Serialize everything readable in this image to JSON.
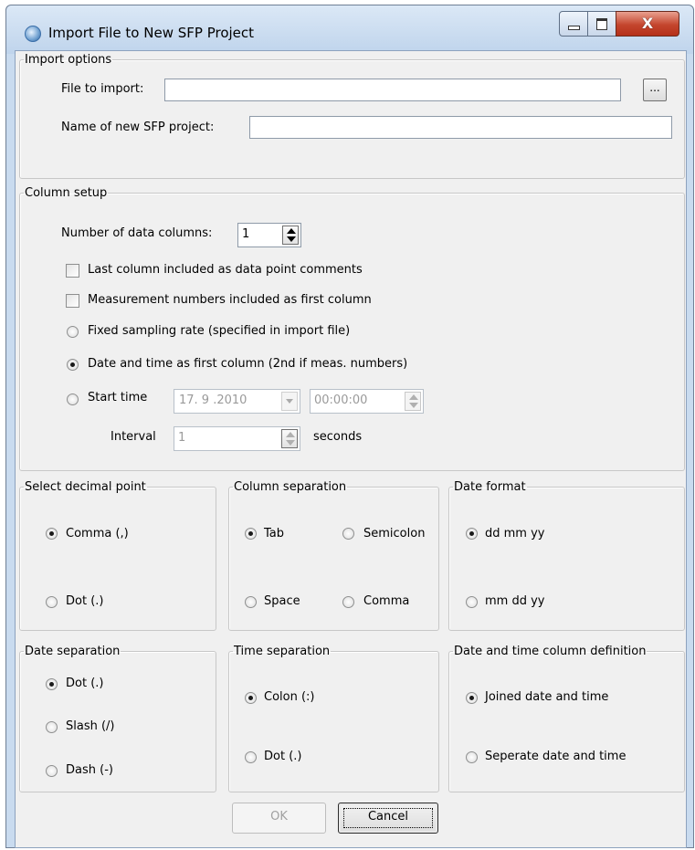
{
  "window": {
    "title": "Import File to New SFP Project",
    "close_glyph": "X"
  },
  "import_options": {
    "legend": "Import options",
    "file_label": "File to import:",
    "file_value": "",
    "browse_label": "...",
    "name_label": "Name of new SFP project:",
    "name_value": ""
  },
  "column_setup": {
    "legend": "Column setup",
    "num_columns_label": "Number of data columns:",
    "num_columns_value": "1",
    "last_column_comments": {
      "label": "Last column included as data point comments",
      "checked": false
    },
    "measurement_numbers": {
      "label": "Measurement numbers included as first column",
      "checked": false
    },
    "fixed_rate": {
      "label": "Fixed sampling rate (specified in import file)",
      "selected": false
    },
    "date_time_first": {
      "label": "Date and time as first column (2nd if meas. numbers)",
      "selected": true
    },
    "start_time": {
      "label": "Start time",
      "selected": false,
      "date_value": "17. 9 .2010",
      "time_value": "00:00:00"
    },
    "interval_label": "Interval",
    "interval_value": "1",
    "interval_unit": "seconds"
  },
  "decimal_point": {
    "legend": "Select decimal point",
    "options": [
      {
        "label": "Comma (,)",
        "selected": true
      },
      {
        "label": "Dot (.)",
        "selected": false
      }
    ]
  },
  "column_separation": {
    "legend": "Column separation",
    "options": [
      {
        "label": "Tab",
        "selected": true
      },
      {
        "label": "Semicolon",
        "selected": false
      },
      {
        "label": "Space",
        "selected": false
      },
      {
        "label": "Comma",
        "selected": false
      }
    ]
  },
  "date_format": {
    "legend": "Date format",
    "options": [
      {
        "label": "dd mm yy",
        "selected": true
      },
      {
        "label": "mm dd yy",
        "selected": false
      }
    ]
  },
  "date_separation": {
    "legend": "Date separation",
    "options": [
      {
        "label": "Dot (.)",
        "selected": true
      },
      {
        "label": "Slash (/)",
        "selected": false
      },
      {
        "label": "Dash (-)",
        "selected": false
      }
    ]
  },
  "time_separation": {
    "legend": "Time separation",
    "options": [
      {
        "label": "Colon (:)",
        "selected": true
      },
      {
        "label": "Dot (.)",
        "selected": false
      }
    ]
  },
  "date_time_column": {
    "legend": "Date and time column definition",
    "options": [
      {
        "label": "Joined date and time",
        "selected": true
      },
      {
        "label": "Seperate date and time",
        "selected": false
      }
    ]
  },
  "buttons": {
    "ok_label": "OK",
    "ok_enabled": false,
    "cancel_label": "Cancel"
  },
  "colors": {
    "titlebar": "#c9dbef",
    "client_bg": "#f0f0f0",
    "close_button": "#c4452d"
  },
  "icons": [
    "app-globe-icon",
    "minimize-icon",
    "maximize-icon",
    "close-icon"
  ]
}
